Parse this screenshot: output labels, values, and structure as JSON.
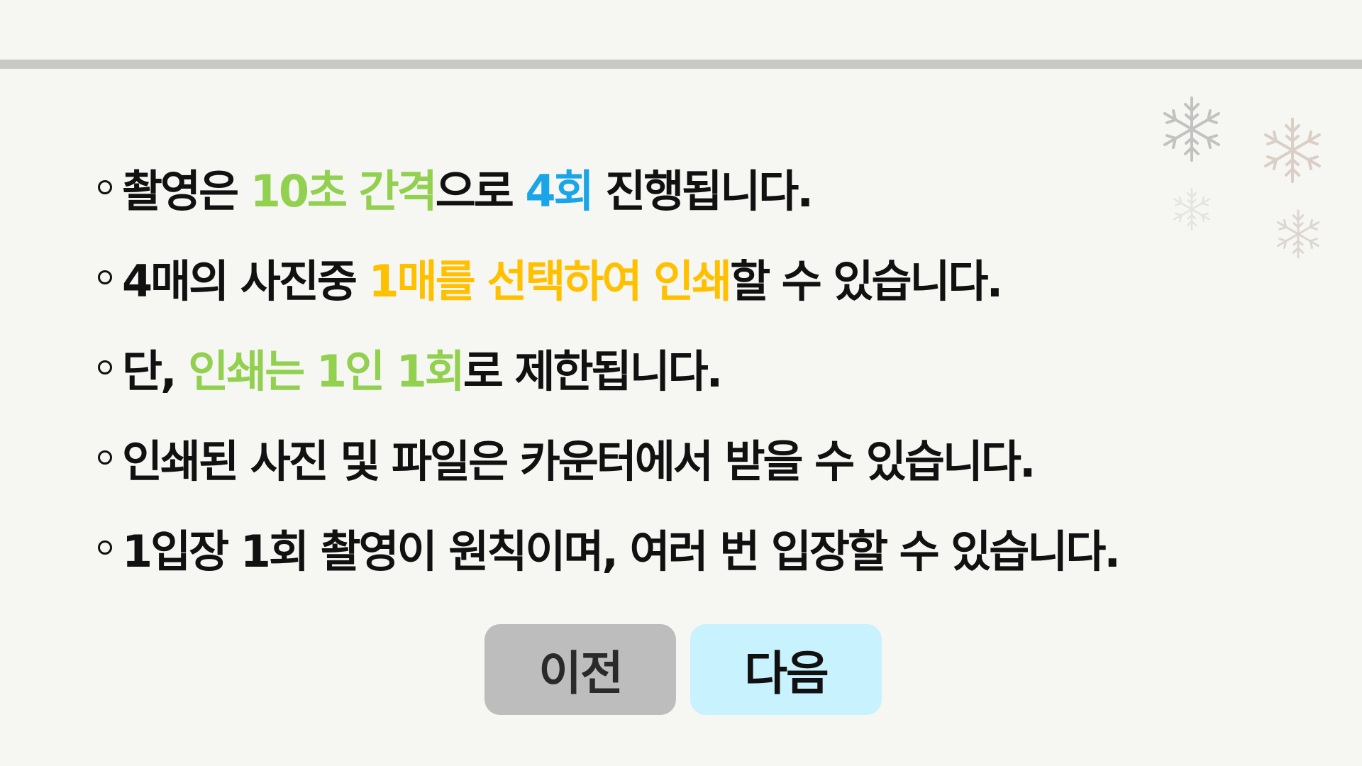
{
  "rules": [
    {
      "segments": [
        {
          "text": "촬영은 ",
          "color": "#111111"
        },
        {
          "text": "10초 간격",
          "color": "#92d050"
        },
        {
          "text": "으로 ",
          "color": "#111111"
        },
        {
          "text": "4회",
          "color": "#1aa5e8"
        },
        {
          "text": " 진행됩니다.",
          "color": "#111111"
        }
      ]
    },
    {
      "segments": [
        {
          "text": "4매의 사진중 ",
          "color": "#111111"
        },
        {
          "text": "1매를 선택하여 인쇄",
          "color": "#ffc000"
        },
        {
          "text": "할 수 있습니다.",
          "color": "#111111"
        }
      ]
    },
    {
      "segments": [
        {
          "text": "단, ",
          "color": "#111111"
        },
        {
          "text": "인쇄는 1인 1회",
          "color": "#92d050"
        },
        {
          "text": "로 제한됩니다.",
          "color": "#111111"
        }
      ]
    },
    {
      "segments": [
        {
          "text": "인쇄된 사진 및 파일은 카운터에서 받을 수 있습니다.",
          "color": "#111111"
        }
      ]
    },
    {
      "segments": [
        {
          "text": "1입장 1회 촬영이 원칙이며, 여러 번 입장할 수 있습니다.",
          "color": "#111111"
        }
      ]
    }
  ],
  "buttons": {
    "prev_label": "이전",
    "next_label": "다음"
  },
  "decor": {
    "snowflake_icon": "snowflake-icon",
    "snowflake_color": "#b8b8b8"
  },
  "colors": {
    "background": "#f6f6f3",
    "divider": "#c8c8c6",
    "highlight_green": "#92d050",
    "highlight_blue": "#1aa5e8",
    "highlight_yellow": "#ffc000",
    "prev_button": "#bdbdbd",
    "next_button": "#c8f2fd"
  }
}
